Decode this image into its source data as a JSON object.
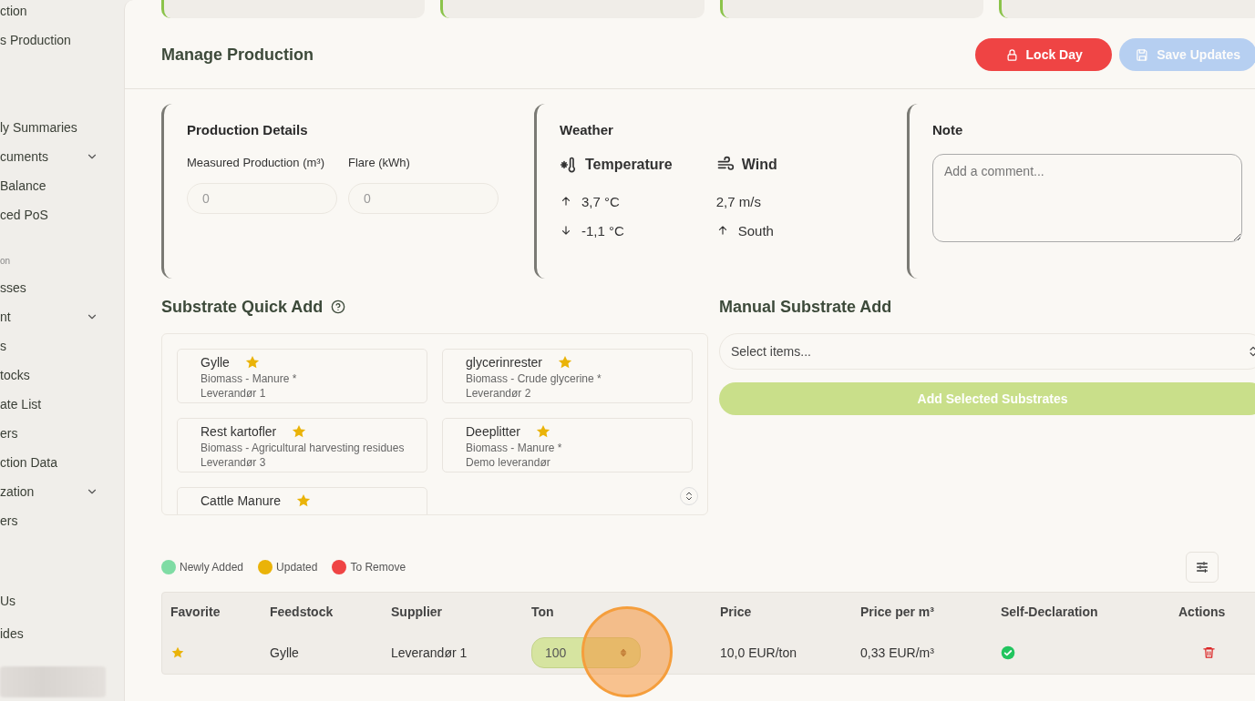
{
  "sidebar": {
    "groups": [
      {
        "items": [
          {
            "label": "ction",
            "expandable": false
          },
          {
            "label": "s Production",
            "expandable": false
          }
        ]
      },
      {
        "items": [
          {
            "label": "ly Summaries",
            "expandable": false
          },
          {
            "label": "cuments",
            "expandable": true
          },
          {
            "label": "Balance",
            "expandable": false
          },
          {
            "label": "ced PoS",
            "expandable": false
          }
        ]
      },
      {
        "heading": "on",
        "items": [
          {
            "label": "sses",
            "expandable": false
          },
          {
            "label": "nt",
            "expandable": true
          },
          {
            "label": "s",
            "expandable": false
          },
          {
            "label": "tocks",
            "expandable": false
          },
          {
            "label": "ate List",
            "expandable": false
          },
          {
            "label": "ers",
            "expandable": false
          },
          {
            "label": "ction Data",
            "expandable": false
          },
          {
            "label": "zation",
            "expandable": true
          },
          {
            "label": "ers",
            "expandable": false
          }
        ]
      },
      {
        "items": [
          {
            "label": "Us",
            "expandable": false
          },
          {
            "label": "ides",
            "expandable": false
          }
        ]
      }
    ]
  },
  "stat_cards": [
    {
      "kind": "card"
    },
    {
      "kind": "card"
    },
    {
      "kind": "card"
    },
    {
      "kind": "card"
    }
  ],
  "header": {
    "title": "Manage Production",
    "buttons": [
      {
        "label": "Lock Day",
        "kind": "lock",
        "disabled": false
      },
      {
        "label": "Save Updates",
        "kind": "save",
        "disabled": true
      }
    ]
  },
  "production_details": {
    "title": "Production Details",
    "fields": [
      {
        "label": "Measured Production (m³)",
        "placeholder": "0"
      },
      {
        "label": "Flare (kWh)",
        "placeholder": "0"
      }
    ]
  },
  "weather": {
    "title": "Weather",
    "temperature": {
      "label": "Temperature",
      "high": "3,7 °C",
      "low": "-1,1 °C"
    },
    "wind": {
      "label": "Wind",
      "speed": "2,7 m/s",
      "direction": "South"
    }
  },
  "note": {
    "title": "Note",
    "placeholder": "Add a comment..."
  },
  "quick_add": {
    "title": "Substrate Quick Add",
    "items": [
      {
        "name": "Gylle",
        "category": "Biomass - Manure *",
        "supplier": "Leverandør 1",
        "favorite": true
      },
      {
        "name": "glycerinrester",
        "category": "Biomass - Crude glycerine *",
        "supplier": "Leverandør 2",
        "favorite": true
      },
      {
        "name": "Rest kartofler",
        "category": "Biomass - Agricultural harvesting residues",
        "supplier": "Leverandør 3",
        "favorite": true
      },
      {
        "name": "Deeplitter",
        "category": "Biomass - Manure *",
        "supplier": "Demo leverandør",
        "favorite": true
      },
      {
        "name": "Cattle Manure",
        "favorite": true
      }
    ]
  },
  "manual_add": {
    "title": "Manual Substrate Add",
    "select": {
      "placeholder": "Select items..."
    },
    "button": {
      "label": "Add Selected Substrates",
      "disabled": true
    }
  },
  "legend": [
    {
      "label": "Newly Added",
      "color": "#7fdca4"
    },
    {
      "label": "Updated",
      "color": "#eab308"
    },
    {
      "label": "To Remove",
      "color": "#ef4444"
    }
  ],
  "table": {
    "columns": [
      "Favorite",
      "Feedstock",
      "Supplier",
      "Ton",
      "Price",
      "Price per m³",
      "Self-Declaration",
      "Actions"
    ],
    "rows": [
      {
        "favorite": true,
        "feedstock": "Gylle",
        "supplier": "Leverandør 1",
        "ton": "100",
        "price": "10,0 EUR/ton",
        "price_per_m3": "0,33 EUR/m³",
        "self_declaration": true
      }
    ]
  }
}
